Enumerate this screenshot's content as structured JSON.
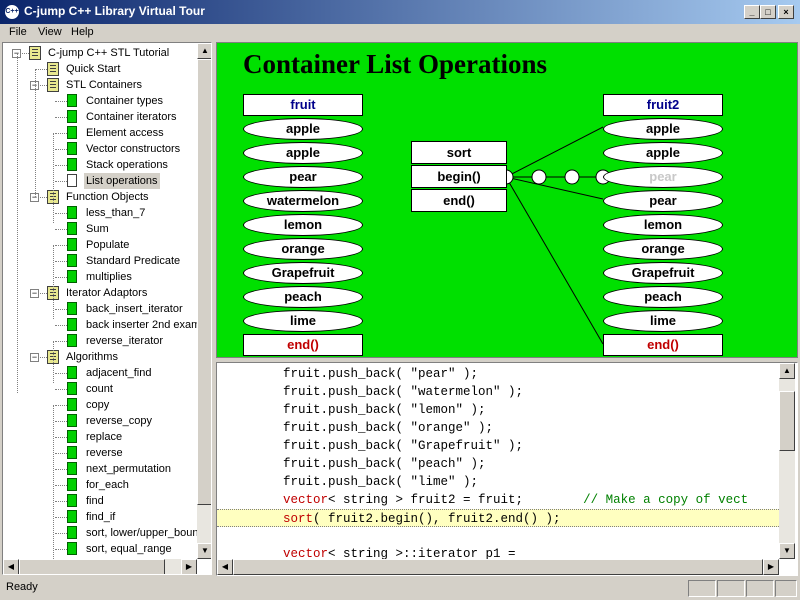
{
  "window": {
    "title": "C-jump C++ Library Virtual Tour",
    "icon_text": "C++",
    "minimize": "_",
    "maximize": "□",
    "close": "×"
  },
  "menu": [
    "File",
    "View",
    "Help"
  ],
  "tree": [
    {
      "label": "C-jump C++ STL Tutorial",
      "level": 0,
      "type": "book",
      "expanded": true
    },
    {
      "label": "Quick Start",
      "level": 1,
      "type": "book",
      "expanded": null
    },
    {
      "label": "STL Containers",
      "level": 1,
      "type": "book",
      "expanded": true
    },
    {
      "label": "Container types",
      "level": 2,
      "type": "page"
    },
    {
      "label": "Container iterators",
      "level": 2,
      "type": "page"
    },
    {
      "label": "Element access",
      "level": 2,
      "type": "page"
    },
    {
      "label": "Vector constructors",
      "level": 2,
      "type": "page"
    },
    {
      "label": "Stack operations",
      "level": 2,
      "type": "page"
    },
    {
      "label": "List operations",
      "level": 2,
      "type": "page",
      "selected": true
    },
    {
      "label": "Function Objects",
      "level": 1,
      "type": "book",
      "expanded": true
    },
    {
      "label": "less_than_7",
      "level": 2,
      "type": "page"
    },
    {
      "label": "Sum",
      "level": 2,
      "type": "page"
    },
    {
      "label": "Populate",
      "level": 2,
      "type": "page"
    },
    {
      "label": "Standard Predicate",
      "level": 2,
      "type": "page"
    },
    {
      "label": "multiplies",
      "level": 2,
      "type": "page"
    },
    {
      "label": "Iterator Adaptors",
      "level": 1,
      "type": "book",
      "expanded": true
    },
    {
      "label": "back_insert_iterator",
      "level": 2,
      "type": "page"
    },
    {
      "label": "back inserter 2nd exam",
      "level": 2,
      "type": "page"
    },
    {
      "label": "reverse_iterator",
      "level": 2,
      "type": "page"
    },
    {
      "label": "Algorithms",
      "level": 1,
      "type": "book",
      "expanded": true
    },
    {
      "label": "adjacent_find",
      "level": 2,
      "type": "page"
    },
    {
      "label": "count",
      "level": 2,
      "type": "page"
    },
    {
      "label": "copy",
      "level": 2,
      "type": "page"
    },
    {
      "label": "reverse_copy",
      "level": 2,
      "type": "page"
    },
    {
      "label": "replace",
      "level": 2,
      "type": "page"
    },
    {
      "label": "reverse",
      "level": 2,
      "type": "page"
    },
    {
      "label": "next_permutation",
      "level": 2,
      "type": "page"
    },
    {
      "label": "for_each",
      "level": 2,
      "type": "page"
    },
    {
      "label": "find",
      "level": 2,
      "type": "page"
    },
    {
      "label": "find_if",
      "level": 2,
      "type": "page"
    },
    {
      "label": "sort, lower/upper_boun",
      "level": 2,
      "type": "page"
    },
    {
      "label": "sort, equal_range",
      "level": 2,
      "type": "page"
    }
  ],
  "diagram": {
    "title": "Container List Operations",
    "left_header": "fruit",
    "left_items": [
      "apple",
      "apple",
      "pear",
      "watermelon",
      "lemon",
      "orange",
      "Grapefruit",
      "peach",
      "lime"
    ],
    "left_end": "end()",
    "right_header": "fruit2",
    "right_items": [
      "apple",
      "apple",
      "pear",
      "pear",
      "lemon",
      "orange",
      "Grapefruit",
      "peach",
      "lime"
    ],
    "right_faded_index": 2,
    "right_end": "end()",
    "ops": [
      "sort",
      "begin()",
      "end()"
    ],
    "colors": {
      "background": "#00e000",
      "header": "#00008b",
      "end": "#c00000"
    }
  },
  "code": {
    "lines": [
      [
        {
          "t": "fruit.push_back( \"pear\" );",
          "c": ""
        }
      ],
      [
        {
          "t": "fruit.push_back( \"watermelon\" );",
          "c": ""
        }
      ],
      [
        {
          "t": "fruit.push_back( \"lemon\" );",
          "c": ""
        }
      ],
      [
        {
          "t": "fruit.push_back( \"orange\" );",
          "c": ""
        }
      ],
      [
        {
          "t": "fruit.push_back( \"Grapefruit\" );",
          "c": ""
        }
      ],
      [
        {
          "t": "fruit.push_back( \"peach\" );",
          "c": ""
        }
      ],
      [
        {
          "t": "fruit.push_back( \"lime\" );",
          "c": ""
        }
      ],
      [
        {
          "t": "vector",
          "c": "kw"
        },
        {
          "t": "< string > fruit2 = fruit;        ",
          "c": ""
        },
        {
          "t": "// Make a copy of vect",
          "c": "cm"
        }
      ],
      [
        {
          "t": "sort",
          "c": "kw"
        },
        {
          "t": "( fruit2.begin(), fruit2.end() );",
          "c": ""
        }
      ],
      [
        {
          "t": "",
          "c": ""
        }
      ],
      [
        {
          "t": "vector",
          "c": "kw"
        },
        {
          "t": "< string >::iterator p1 =",
          "c": ""
        }
      ]
    ],
    "highlight_index": 8
  },
  "status": {
    "text": "Ready"
  }
}
